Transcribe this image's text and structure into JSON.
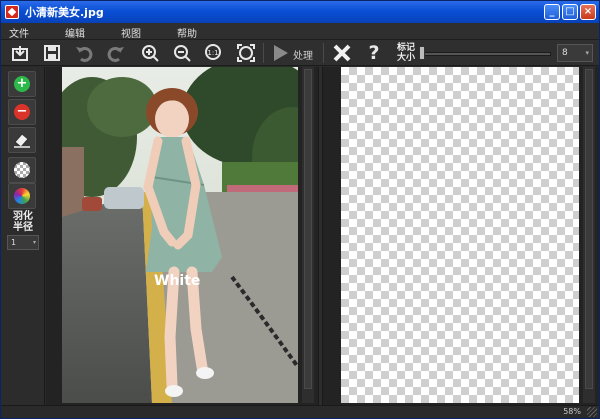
{
  "window": {
    "title": "小清新美女.jpg",
    "minimize": "_",
    "maximize": "□",
    "close": "×"
  },
  "menu": {
    "file": "文件",
    "edit": "编辑",
    "view": "视图",
    "help": "帮助"
  },
  "toolbar": {
    "process_label": "处理",
    "mark_size_label_line1": "标记",
    "mark_size_label_line2": "大小",
    "mark_size_value": "8",
    "mark_size_fraction": 0.0,
    "icons": [
      "import-icon",
      "save-icon",
      "undo-icon",
      "redo-icon",
      "zoom-in-icon",
      "zoom-out-icon",
      "actual-size-icon",
      "fit-window-icon",
      "play-icon",
      "clear-icon",
      "help-icon"
    ]
  },
  "left_panel": {
    "tools": [
      "add-mark-icon",
      "remove-mark-icon",
      "eraser-icon",
      "transparent-icon",
      "color-wheel-icon"
    ],
    "feather_label_line1": "羽化",
    "feather_label_line2": "半径",
    "feather_value": "1"
  },
  "photo": {
    "watermark_text": "White"
  },
  "status": {
    "zoom": "58%"
  },
  "colors": {
    "titlebar": "#0a4fd6",
    "add": "#2db84a",
    "remove": "#d9332a",
    "panel": "#2f2f2f"
  }
}
